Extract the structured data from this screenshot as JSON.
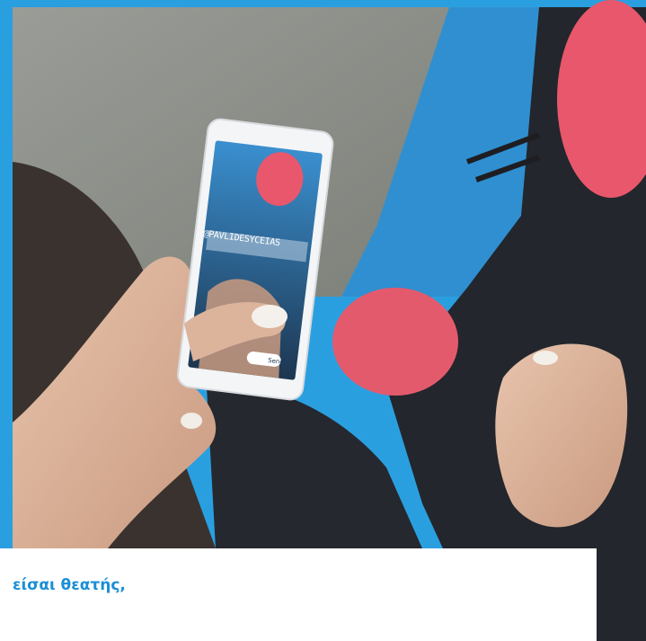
{
  "photo": {
    "screen_handle": "@PAVLIDESYCEIAS",
    "screen_button": "Send"
  },
  "caption": {
    "title": "είσαι θεατής,",
    "subtitle": ""
  },
  "colors": {
    "frame_blue": "#2a9fe0",
    "asphalt": "#8a8d87",
    "shoe_pink": "#e8576b",
    "legging_dark": "#2a2d33",
    "caption_blue": "#1b8fd6"
  }
}
